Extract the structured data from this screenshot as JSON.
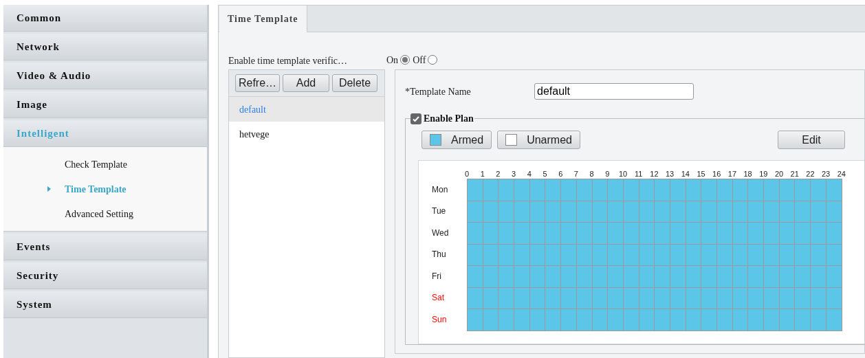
{
  "sidebar": {
    "items": [
      {
        "label": "Common",
        "selected": false
      },
      {
        "label": "Network",
        "selected": false
      },
      {
        "label": "Video & Audio",
        "selected": false
      },
      {
        "label": "Image",
        "selected": false
      },
      {
        "label": "Intelligent",
        "selected": true,
        "expanded": true,
        "children": [
          {
            "label": "Check Template",
            "selected": false
          },
          {
            "label": "Time Template",
            "selected": true
          },
          {
            "label": "Advanced Setting",
            "selected": false
          }
        ]
      },
      {
        "label": "Events",
        "selected": false
      },
      {
        "label": "Security",
        "selected": false
      },
      {
        "label": "System",
        "selected": false
      }
    ]
  },
  "tabs": [
    {
      "label": "Time Template",
      "selected": true
    }
  ],
  "verification": {
    "label": "Enable time template verific…",
    "options": [
      {
        "label": "On",
        "selected": true
      },
      {
        "label": "Off",
        "selected": false
      }
    ]
  },
  "template_list": {
    "buttons": [
      "Refre…",
      "Add",
      "Delete"
    ],
    "items": [
      {
        "label": "default",
        "selected": true
      },
      {
        "label": "hetvege",
        "selected": false
      }
    ]
  },
  "template_name": {
    "label": "*Template Name",
    "value": "default"
  },
  "enable_plan": {
    "label": "Enable Plan",
    "checked": true
  },
  "legend": [
    {
      "label": "Armed",
      "color": "#5bc6e8"
    },
    {
      "label": "Unarmed",
      "color": "#ffffff"
    }
  ],
  "edit_button": "Edit",
  "schedule": {
    "hours": [
      "0",
      "1",
      "2",
      "3",
      "4",
      "5",
      "6",
      "7",
      "8",
      "9",
      "10",
      "11",
      "12",
      "13",
      "14",
      "15",
      "16",
      "17",
      "18",
      "19",
      "20",
      "21",
      "22",
      "23",
      "24"
    ],
    "days": [
      {
        "label": "Mon",
        "color": "#222222",
        "armed": [
          true,
          true,
          true,
          true,
          true,
          true,
          true,
          true,
          true,
          true,
          true,
          true,
          true,
          true,
          true,
          true,
          true,
          true,
          true,
          true,
          true,
          true,
          true,
          true
        ]
      },
      {
        "label": "Tue",
        "color": "#222222",
        "armed": [
          true,
          true,
          true,
          true,
          true,
          true,
          true,
          true,
          true,
          true,
          true,
          true,
          true,
          true,
          true,
          true,
          true,
          true,
          true,
          true,
          true,
          true,
          true,
          true
        ]
      },
      {
        "label": "Wed",
        "color": "#222222",
        "armed": [
          true,
          true,
          true,
          true,
          true,
          true,
          true,
          true,
          true,
          true,
          true,
          true,
          true,
          true,
          true,
          true,
          true,
          true,
          true,
          true,
          true,
          true,
          true,
          true
        ]
      },
      {
        "label": "Thu",
        "color": "#222222",
        "armed": [
          true,
          true,
          true,
          true,
          true,
          true,
          true,
          true,
          true,
          true,
          true,
          true,
          true,
          true,
          true,
          true,
          true,
          true,
          true,
          true,
          true,
          true,
          true,
          true
        ]
      },
      {
        "label": "Fri",
        "color": "#222222",
        "armed": [
          true,
          true,
          true,
          true,
          true,
          true,
          true,
          true,
          true,
          true,
          true,
          true,
          true,
          true,
          true,
          true,
          true,
          true,
          true,
          true,
          true,
          true,
          true,
          true
        ]
      },
      {
        "label": "Sat",
        "color": "#ff0000",
        "armed": [
          true,
          true,
          true,
          true,
          true,
          true,
          true,
          true,
          true,
          true,
          true,
          true,
          true,
          true,
          true,
          true,
          true,
          true,
          true,
          true,
          true,
          true,
          true,
          true
        ]
      },
      {
        "label": "Sun",
        "color": "#ff0000",
        "armed": [
          true,
          true,
          true,
          true,
          true,
          true,
          true,
          true,
          true,
          true,
          true,
          true,
          true,
          true,
          true,
          true,
          true,
          true,
          true,
          true,
          true,
          true,
          true,
          true
        ]
      }
    ]
  }
}
